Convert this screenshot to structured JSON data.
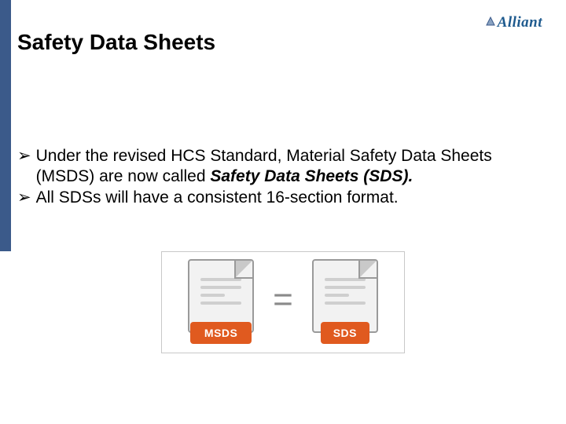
{
  "brand": {
    "name": "Alliant"
  },
  "title": "Safety Data Sheets",
  "bullets": [
    {
      "pre": "Under the revised HCS Standard, Material Safety Data Sheets (MSDS) are now called ",
      "bold": "Safety Data Sheets (SDS)."
    },
    {
      "text": "All SDSs will have a consistent 16-section format."
    }
  ],
  "graphic": {
    "left_label": "MSDS",
    "equals": "=",
    "right_label": "SDS"
  }
}
